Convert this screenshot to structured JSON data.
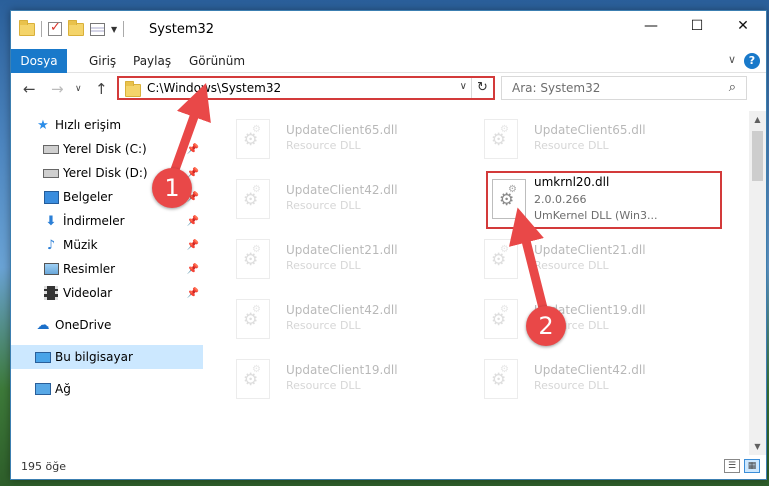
{
  "window": {
    "title": "System32"
  },
  "window_controls": {
    "minimize": "—",
    "maximize": "☐",
    "close": "✕"
  },
  "ribbon": {
    "tabs": [
      "Dosya",
      "Giriş",
      "Paylaş",
      "Görünüm"
    ],
    "help": "?"
  },
  "address": {
    "path": "C:\\Windows\\System32",
    "search_placeholder": "Ara: System32"
  },
  "sidebar": {
    "items": [
      {
        "label": "Hızlı erişim",
        "icon": "star-icon"
      },
      {
        "label": "Yerel Disk (C:)",
        "icon": "disk-icon"
      },
      {
        "label": "Yerel Disk (D:)",
        "icon": "disk-icon"
      },
      {
        "label": "Belgeler",
        "icon": "documents-icon"
      },
      {
        "label": "İndirmeler",
        "icon": "download-icon"
      },
      {
        "label": "Müzik",
        "icon": "music-icon"
      },
      {
        "label": "Resimler",
        "icon": "pictures-icon"
      },
      {
        "label": "Videolar",
        "icon": "videos-icon"
      },
      {
        "label": "OneDrive",
        "icon": "cloud-icon"
      },
      {
        "label": "Bu bilgisayar",
        "icon": "computer-icon"
      },
      {
        "label": "Ağ",
        "icon": "network-icon"
      }
    ]
  },
  "files": [
    {
      "name": "UpdateClient65.dll",
      "desc": "Resource DLL"
    },
    {
      "name": "UpdateClient65.dll",
      "desc": "Resource DLL"
    },
    {
      "name": "UpdateClient42.dll",
      "desc": "Resource DLL"
    },
    {
      "name": "umkrnl20.dll",
      "version": "2.0.0.266",
      "desc": "UmKernel DLL  (Win3..."
    },
    {
      "name": "UpdateClient21.dll",
      "desc": "Resource DLL"
    },
    {
      "name": "UpdateClient21.dll",
      "desc": "Resource DLL"
    },
    {
      "name": "UpdateClient42.dll",
      "desc": "Resource DLL"
    },
    {
      "name": "UpdateClient19.dll",
      "desc": "Resource DLL"
    },
    {
      "name": "UpdateClient19.dll",
      "desc": "Resource DLL"
    },
    {
      "name": "UpdateClient42.dll",
      "desc": "Resource DLL"
    }
  ],
  "status": {
    "item_count": "195 öğe"
  },
  "annotations": {
    "step1": "1",
    "step2": "2"
  },
  "colors": {
    "accent": "#1979ca",
    "highlight_red": "#d33a3a",
    "badge_red": "#e94848",
    "selected_bg": "#cce8ff"
  }
}
